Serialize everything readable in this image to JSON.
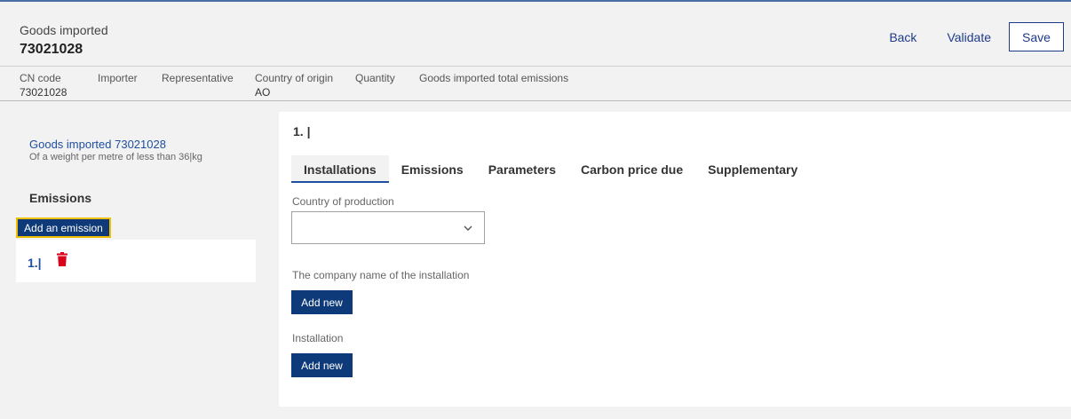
{
  "header": {
    "title": "Goods imported",
    "code": "73021028",
    "back_label": "Back",
    "validate_label": "Validate",
    "save_label": "Save"
  },
  "summary": {
    "cn_code_label": "CN code",
    "cn_code_value": "73021028",
    "importer_label": "Importer",
    "representative_label": "Representative",
    "country_origin_label": "Country of origin",
    "country_origin_value": "AO",
    "quantity_label": "Quantity",
    "total_emissions_label": "Goods imported total emissions"
  },
  "left_panel": {
    "goods_link": "Goods imported 73021028",
    "description": "Of a weight per metre of less than 36|kg",
    "heading": "Emissions",
    "add_button": "Add an emission",
    "items": [
      {
        "label": "1.|",
        "icon": "trash-icon"
      }
    ]
  },
  "main_panel": {
    "title": "1. |",
    "tabs": [
      {
        "label": "Installations",
        "active": true
      },
      {
        "label": "Emissions",
        "active": false
      },
      {
        "label": "Parameters",
        "active": false
      },
      {
        "label": "Carbon price due",
        "active": false
      },
      {
        "label": "Supplementary",
        "active": false
      }
    ],
    "country_production_label": "Country of production",
    "country_production_value": "",
    "company_name_label": "The company name of the installation",
    "company_add_label": "Add new",
    "installation_label": "Installation",
    "installation_add_label": "Add new"
  },
  "colors": {
    "primary": "#0e3a7a",
    "link": "#1e4fa0",
    "danger": "#d9001b",
    "focus": "#f0c000"
  }
}
